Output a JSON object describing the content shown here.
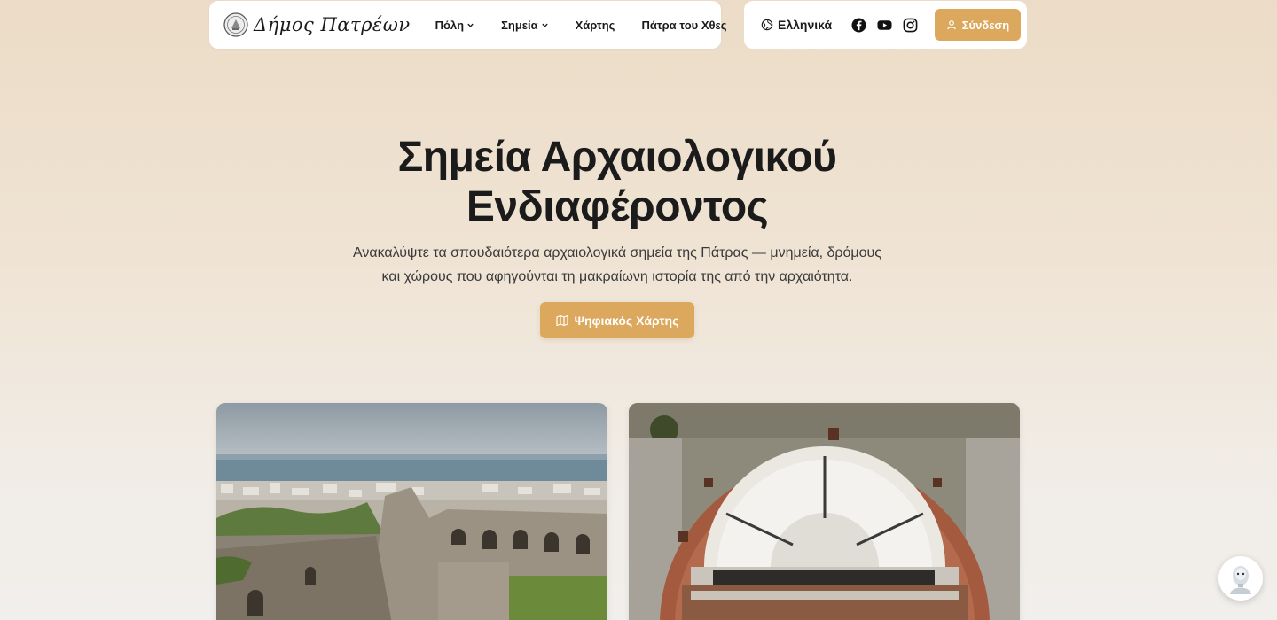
{
  "brand": {
    "name": "Δήμος Πατρέων",
    "logo_icon": "municipal-seal-icon"
  },
  "nav": {
    "items": [
      {
        "label": "Πόλη",
        "has_dropdown": true
      },
      {
        "label": "Σημεία",
        "has_dropdown": true
      },
      {
        "label": "Χάρτης",
        "has_dropdown": false
      },
      {
        "label": "Πάτρα του Χθες",
        "has_dropdown": false
      }
    ]
  },
  "header_right": {
    "language": "Ελληνικά",
    "social": [
      "facebook-icon",
      "youtube-icon",
      "instagram-icon"
    ],
    "login_label": "Σύνδεση"
  },
  "hero": {
    "title_line1": "Σημεία Αρχαιολογικού",
    "title_line2": "Ενδιαφέροντος",
    "subtitle_line1": "Ανακαλύψτε τα σπουδαιότερα αρχαιολογικά σημεία της Πάτρας — μνημεία, δρόμους",
    "subtitle_line2": "και χώρους που αφηγούνται τη μακραίωνη ιστορία της από την αρχαιότητα.",
    "map_button_label": "Ψηφιακός Χάρτης"
  },
  "colors": {
    "accent": "#dca85d",
    "text": "#1b1b1b"
  }
}
